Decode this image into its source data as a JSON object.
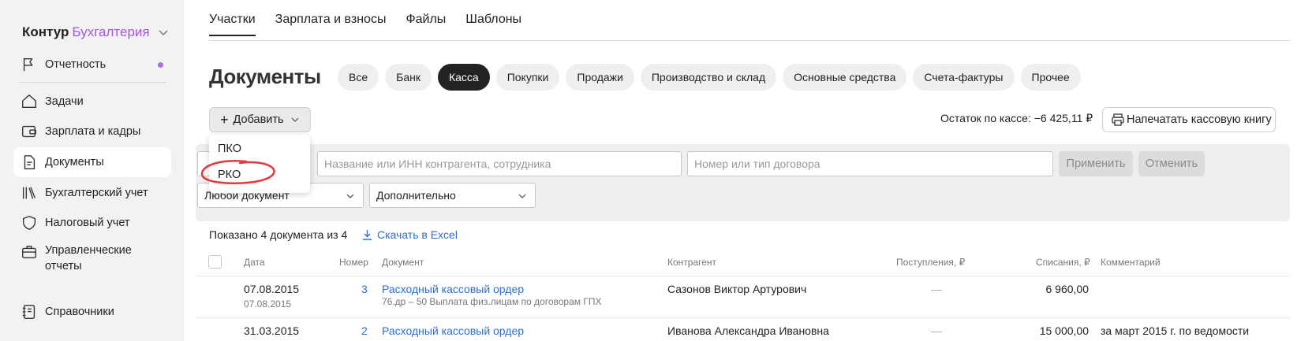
{
  "sidebar": {
    "brand_part1": "Контур",
    "brand_part2": "Бухгалтерия",
    "items": [
      {
        "label": "Отчетность"
      },
      {
        "label": "Задачи"
      },
      {
        "label": "Зарплата и кадры"
      },
      {
        "label": "Документы"
      },
      {
        "label": "Бухгалтерский учет"
      },
      {
        "label": "Налоговый учет"
      },
      {
        "label": "Управленческие отчеты"
      },
      {
        "label": "Справочники"
      }
    ]
  },
  "tabs": [
    {
      "label": "Участки"
    },
    {
      "label": "Зарплата и взносы"
    },
    {
      "label": "Файлы"
    },
    {
      "label": "Шаблоны"
    }
  ],
  "page_title": "Документы",
  "chips": [
    {
      "label": "Все"
    },
    {
      "label": "Банк"
    },
    {
      "label": "Касса"
    },
    {
      "label": "Покупки"
    },
    {
      "label": "Продажи"
    },
    {
      "label": "Производство и склад"
    },
    {
      "label": "Основные средства"
    },
    {
      "label": "Счета-фактуры"
    },
    {
      "label": "Прочее"
    }
  ],
  "add_button": {
    "label": "Добавить"
  },
  "balance": "Остаток по кассе: −6 425,11 ₽",
  "print_button": "Напечатать кассовую книгу",
  "dropdown": {
    "items": [
      "ПКО",
      "РКО"
    ]
  },
  "filters": {
    "counterparty_placeholder": "Название или ИНН контрагента, сотрудника",
    "contract_placeholder": "Номер или тип договора",
    "apply_label": "Применить",
    "cancel_label": "Отменить",
    "doc_type_value": "Любой документ",
    "extra_value": "Дополнительно"
  },
  "table": {
    "shown_text": "Показано 4 документа из 4",
    "excel_label": "Скачать в Excel",
    "headers": [
      "Дата",
      "Номер",
      "Документ",
      "Контрагент",
      "Поступления, ₽",
      "Списания, ₽",
      "Комментарий"
    ],
    "rows": [
      {
        "date": "07.08.2015",
        "date_sub": "07.08.2015",
        "number": "3",
        "doc": "Расходный кассовый ордер",
        "doc_sub": "76.др – 50 Выплата физ.лицам по договорам ГПХ",
        "counterparty": "Сазонов Виктор Артурович",
        "income": "—",
        "expense": "6 960,00",
        "comment": ""
      },
      {
        "date": "31.03.2015",
        "date_sub": "",
        "number": "2",
        "doc": "Расходный кассовый ордер",
        "doc_sub": "",
        "counterparty": "Иванова Александра Ивановна",
        "income": "—",
        "expense": "15 000,00",
        "comment": "за март 2015 г. по ведомости"
      }
    ]
  },
  "colors": {
    "accent_purple": "#a259d9",
    "link_blue": "#2a6fd6",
    "highlight_circle": "#e0393e"
  }
}
